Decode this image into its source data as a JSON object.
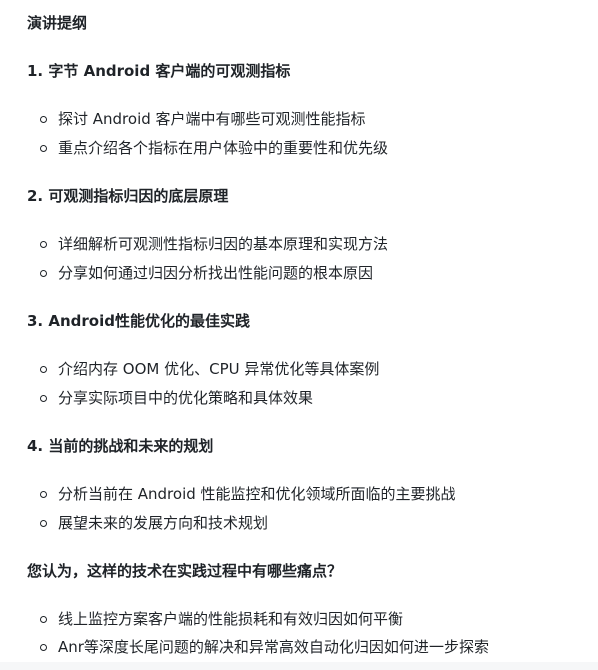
{
  "title": "演讲提纲",
  "sections": [
    {
      "heading": "1. 字节 Android 客户端的可观测指标",
      "items": [
        "探讨 Android 客户端中有哪些可观测性能指标",
        "重点介绍各个指标在用户体验中的重要性和优先级"
      ]
    },
    {
      "heading": "2. 可观测指标归因的底层原理",
      "items": [
        "详细解析可观测性指标归因的基本原理和实现方法",
        "分享如何通过归因分析找出性能问题的根本原因"
      ]
    },
    {
      "heading": "3. Android性能优化的最佳实践",
      "items": [
        "介绍内存 OOM 优化、CPU 异常优化等具体案例",
        "分享实际项目中的优化策略和具体效果"
      ]
    },
    {
      "heading": "4. 当前的挑战和未来的规划",
      "items": [
        "分析当前在 Android 性能监控和优化领域所面临的主要挑战",
        "展望未来的发展方向和技术规划"
      ]
    },
    {
      "heading": "您认为，这样的技术在实践过程中有哪些痛点？",
      "items": [
        "线上监控方案客户端的性能损耗和有效归因如何平衡",
        "Anr等深度长尾问题的解决和异常高效自动化归因如何进一步探索"
      ]
    }
  ]
}
